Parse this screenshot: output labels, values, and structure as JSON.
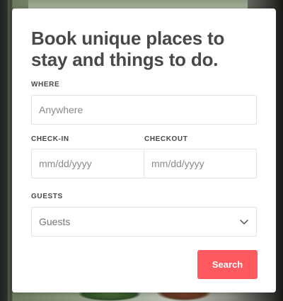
{
  "card": {
    "title": "Book unique places to stay and things to do."
  },
  "where": {
    "label": "WHERE",
    "placeholder": "Anywhere"
  },
  "check_in": {
    "label": "CHECK-IN",
    "placeholder": "mm/dd/yyyy"
  },
  "checkout": {
    "label": "CHECKOUT",
    "placeholder": "mm/dd/yyyy"
  },
  "guests": {
    "label": "GUESTS",
    "selected": "Guests",
    "icon": "chevron-down-icon"
  },
  "search": {
    "label": "Search",
    "color": "#ff5a5f"
  }
}
